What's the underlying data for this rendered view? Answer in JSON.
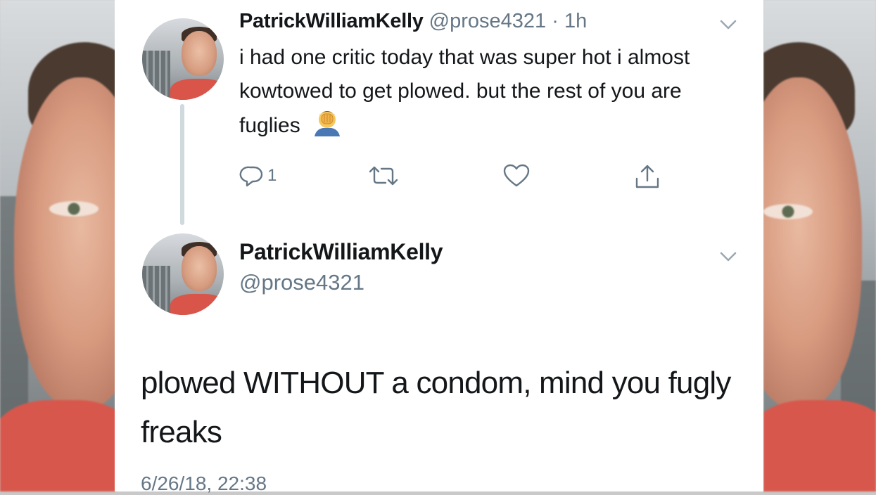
{
  "tweet1": {
    "display_name": "PatrickWilliamKelly",
    "handle": "@prose4321",
    "time": "· 1h",
    "text": "i had one critic today that was super hot i almost kowtowed to get plowed. but the rest of you are fuglies",
    "emoji": "face-palm-emoji",
    "reply_count": "1"
  },
  "tweet2": {
    "display_name": "PatrickWilliamKelly",
    "handle": "@prose4321",
    "text": "plowed WITHOUT a condom, mind you fugly freaks",
    "timestamp": "6/26/18, 22:38"
  },
  "icons": [
    "chevron-down-icon",
    "reply-icon",
    "retweet-icon",
    "like-icon",
    "share-icon"
  ],
  "colors": {
    "text": "#14171a",
    "secondary": "#657786",
    "thread_line": "#cfd9de",
    "background": "#ffffff"
  }
}
